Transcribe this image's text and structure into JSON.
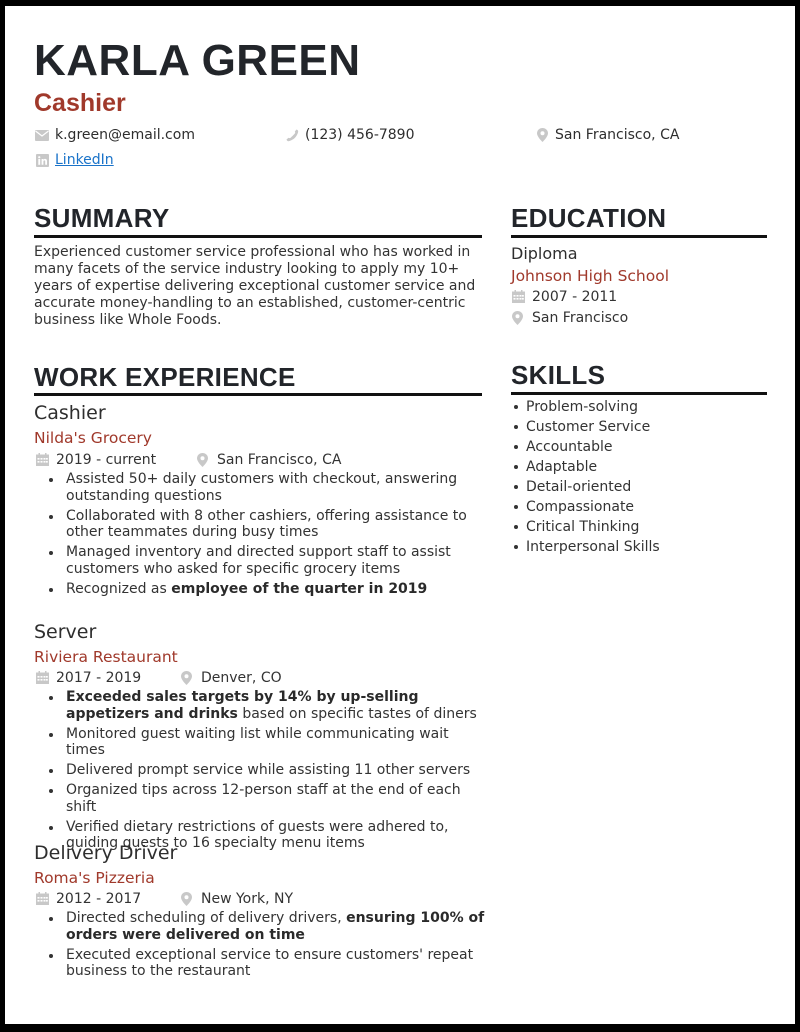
{
  "header": {
    "name": "KARLA GREEN",
    "title": "Cashier",
    "email": "k.green@email.com",
    "phone": "(123) 456-7890",
    "location": "San Francisco, CA",
    "linkedin_label": "LinkedIn",
    "icons": [
      "envelope-icon",
      "phone-icon",
      "map-pin-icon",
      "linkedin-icon"
    ]
  },
  "summary": {
    "heading": "SUMMARY",
    "text": "Experienced customer service professional who has worked in many facets of the service industry looking to apply my 10+ years of expertise delivering exceptional customer service and accurate money-handling to an established, customer-centric business like Whole Foods."
  },
  "experience": {
    "heading": "WORK EXPERIENCE",
    "jobs": [
      {
        "title": "Cashier",
        "company": "Nilda's Grocery",
        "dates": "2019 - current",
        "location": "San Francisco, CA",
        "bullets": [
          {
            "pre": "Assisted 50+ daily customers with checkout, answering outstanding questions",
            "bold": "",
            "post": ""
          },
          {
            "pre": "Collaborated with 8 other cashiers, offering assistance to other teammates during busy times",
            "bold": "",
            "post": ""
          },
          {
            "pre": "Managed inventory and directed support staff to assist customers who asked for specific grocery items",
            "bold": "",
            "post": ""
          },
          {
            "pre": "Recognized as ",
            "bold": "employee of the quarter in 2019",
            "post": ""
          }
        ]
      },
      {
        "title": "Server",
        "company": "Riviera Restaurant",
        "dates": "2017 - 2019",
        "location": "Denver, CO",
        "bullets": [
          {
            "pre": "",
            "bold": "Exceeded sales targets by 14% by up-selling appetizers and drinks",
            "post": " based on specific tastes of diners"
          },
          {
            "pre": "Monitored guest waiting list while communicating wait times",
            "bold": "",
            "post": ""
          },
          {
            "pre": "Delivered prompt service while assisting 11 other servers",
            "bold": "",
            "post": ""
          },
          {
            "pre": "Organized tips across 12-person staff at the end of each shift",
            "bold": "",
            "post": ""
          },
          {
            "pre": "Verified dietary restrictions of guests were adhered to, guiding guests to 16 specialty menu items",
            "bold": "",
            "post": ""
          }
        ]
      },
      {
        "title": "Delivery Driver",
        "company": "Roma's Pizzeria",
        "dates": "2012 - 2017",
        "location": "New York, NY",
        "bullets": [
          {
            "pre": "Directed scheduling of delivery drivers, ",
            "bold": "ensuring 100% of orders were delivered on time",
            "post": ""
          },
          {
            "pre": "Executed exceptional service to ensure customers' repeat business to the restaurant",
            "bold": "",
            "post": ""
          }
        ]
      }
    ]
  },
  "education": {
    "heading": "EDUCATION",
    "degree": "Diploma",
    "school": "Johnson High School",
    "dates": "2007 - 2011",
    "location": "San Francisco"
  },
  "skills": {
    "heading": "SKILLS",
    "items": [
      "Problem-solving",
      "Customer Service",
      "Accountable",
      "Adaptable",
      "Detail-oriented",
      "Compassionate",
      "Critical Thinking",
      "Interpersonal Skills"
    ]
  },
  "colors": {
    "accent": "#a0392b",
    "heading": "#22252a",
    "link": "#1a73c9",
    "icon": "#c8c8c8"
  }
}
